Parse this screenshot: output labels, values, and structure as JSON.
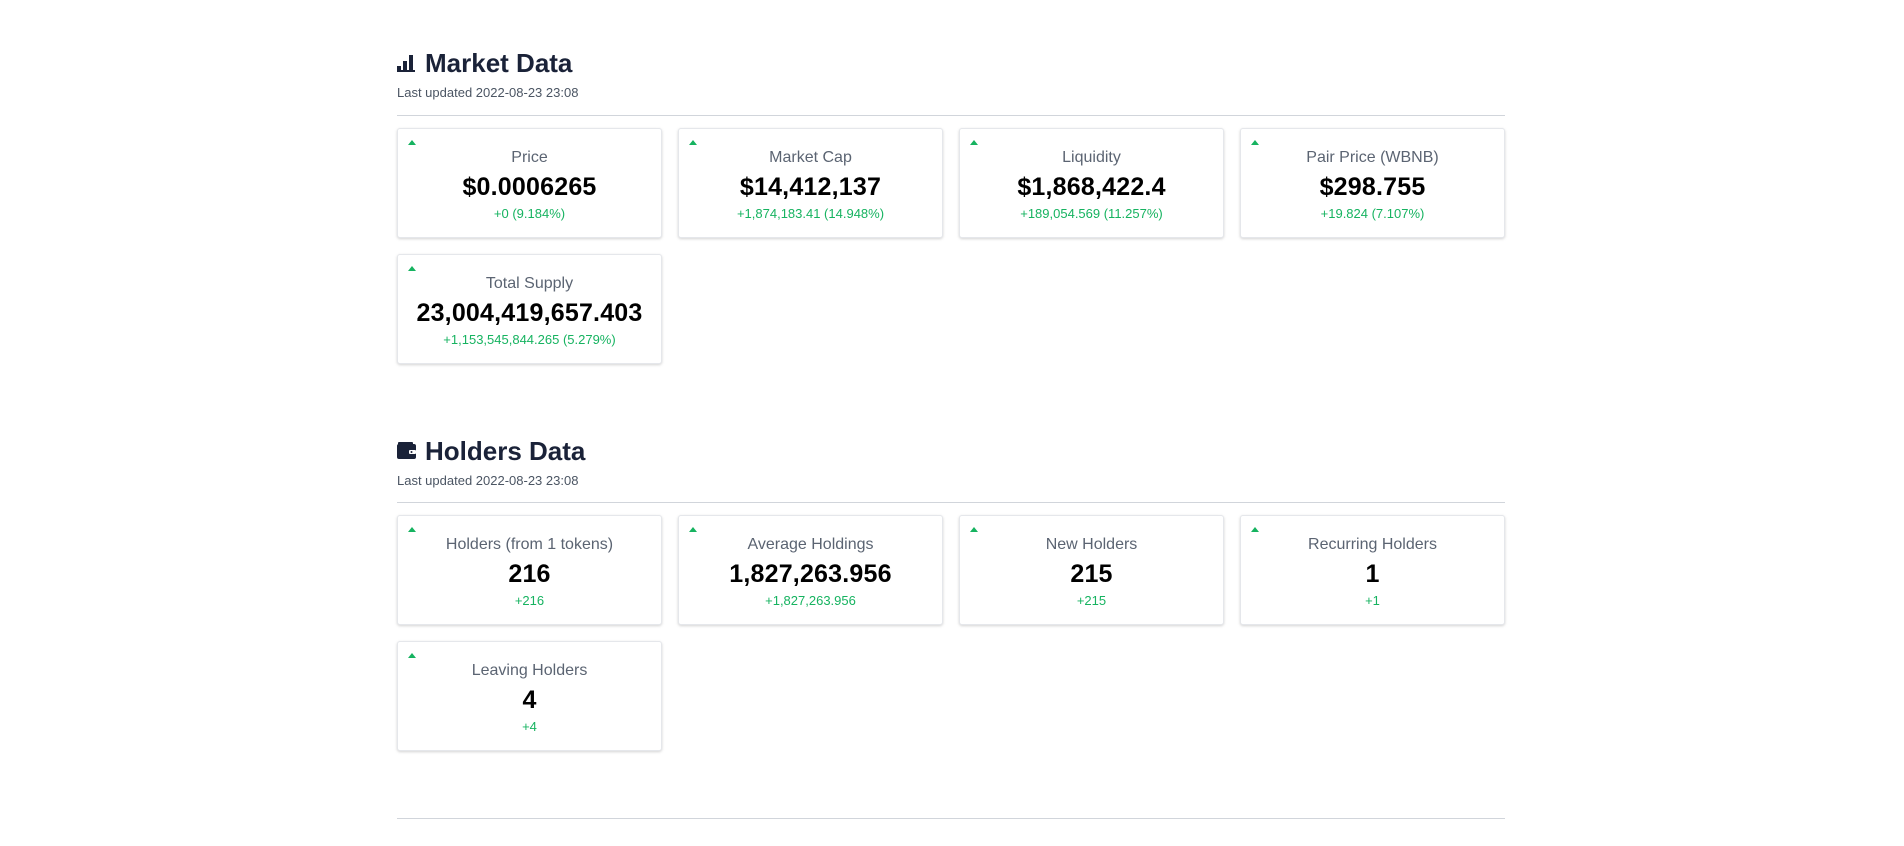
{
  "market": {
    "title": "Market Data",
    "icon": "bar-chart-icon",
    "updated": "Last updated 2022-08-23 23:08",
    "cards": [
      {
        "label": "Price",
        "value": "$0.0006265",
        "change": "+0 (9.184%)"
      },
      {
        "label": "Market Cap",
        "value": "$14,412,137",
        "change": "+1,874,183.41 (14.948%)"
      },
      {
        "label": "Liquidity",
        "value": "$1,868,422.4",
        "change": "+189,054.569 (11.257%)"
      },
      {
        "label": "Pair Price (WBNB)",
        "value": "$298.755",
        "change": "+19.824 (7.107%)"
      },
      {
        "label": "Total Supply",
        "value": "23,004,419,657.403",
        "change": "+1,153,545,844.265 (5.279%)"
      }
    ]
  },
  "holders": {
    "title": "Holders Data",
    "icon": "wallet-icon",
    "updated": "Last updated 2022-08-23 23:08",
    "cards": [
      {
        "label": "Holders (from 1 tokens)",
        "value": "216",
        "change": "+216"
      },
      {
        "label": "Average Holdings",
        "value": "1,827,263.956",
        "change": "+1,827,263.956"
      },
      {
        "label": "New Holders",
        "value": "215",
        "change": "+215"
      },
      {
        "label": "Recurring Holders",
        "value": "1",
        "change": "+1"
      },
      {
        "label": "Leaving Holders",
        "value": "4",
        "change": "+4"
      }
    ]
  },
  "colors": {
    "positive": "#16b360",
    "title": "#1a2238"
  }
}
